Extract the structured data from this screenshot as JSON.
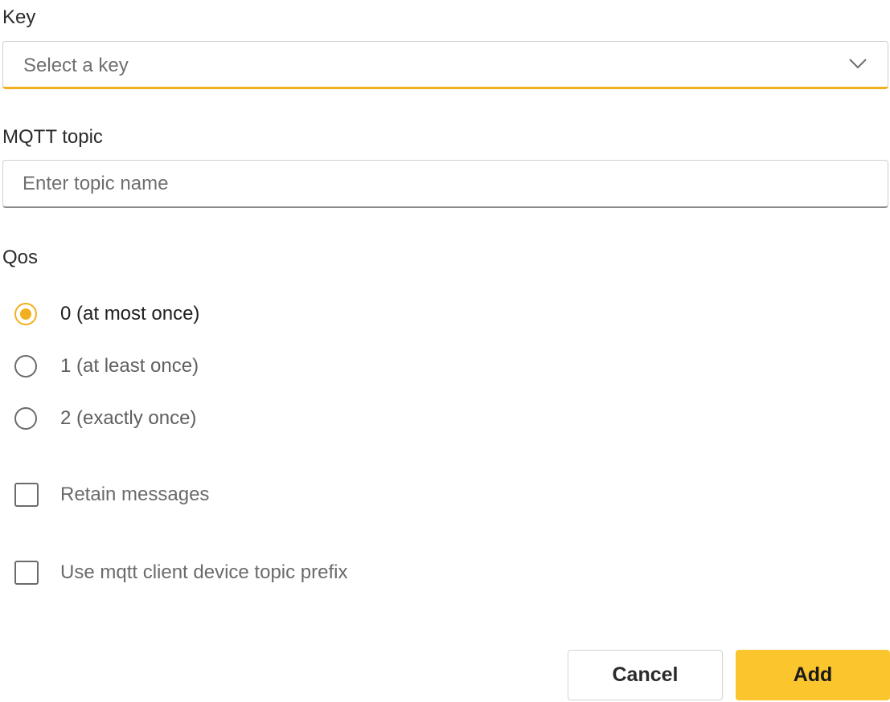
{
  "form": {
    "key": {
      "label": "Key",
      "placeholder": "Select a key"
    },
    "topic": {
      "label": "MQTT topic",
      "placeholder": "Enter topic name",
      "value": ""
    },
    "qos": {
      "label": "Qos",
      "options": [
        {
          "label": "0 (at most once)",
          "selected": true
        },
        {
          "label": "1 (at least once)",
          "selected": false
        },
        {
          "label": "2 (exactly once)",
          "selected": false
        }
      ]
    },
    "retain": {
      "label": "Retain messages",
      "checked": false
    },
    "prefix": {
      "label": "Use mqtt client device topic prefix",
      "checked": false
    }
  },
  "actions": {
    "cancel_label": "Cancel",
    "add_label": "Add"
  },
  "colors": {
    "accent": "#f2b01e",
    "primary_button": "#fbc52d"
  },
  "icons": {
    "key_dropdown": "chevron-down-icon"
  }
}
